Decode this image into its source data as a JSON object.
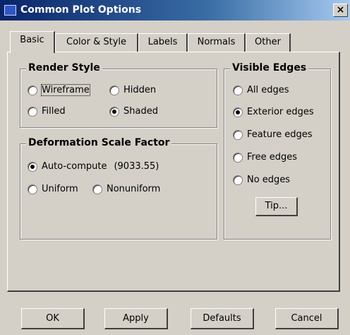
{
  "window": {
    "title": "Common Plot Options",
    "close_glyph": "×"
  },
  "tabs": [
    "Basic",
    "Color & Style",
    "Labels",
    "Normals",
    "Other"
  ],
  "render_style": {
    "title": "Render Style",
    "options": [
      "Wireframe",
      "Hidden",
      "Filled",
      "Shaded"
    ],
    "selected": "Shaded"
  },
  "deformation": {
    "title": "Deformation Scale Factor",
    "auto_label": "Auto-compute",
    "auto_value": "(9033.55)",
    "uniform_label": "Uniform",
    "nonuniform_label": "Nonuniform",
    "selected": "Auto-compute"
  },
  "visible_edges": {
    "title": "Visible Edges",
    "options": [
      "All edges",
      "Exterior edges",
      "Feature edges",
      "Free edges",
      "No edges"
    ],
    "selected": "Exterior edges",
    "tip_label": "Tip..."
  },
  "buttons": {
    "ok": "OK",
    "apply": "Apply",
    "defaults": "Defaults",
    "cancel": "Cancel"
  }
}
